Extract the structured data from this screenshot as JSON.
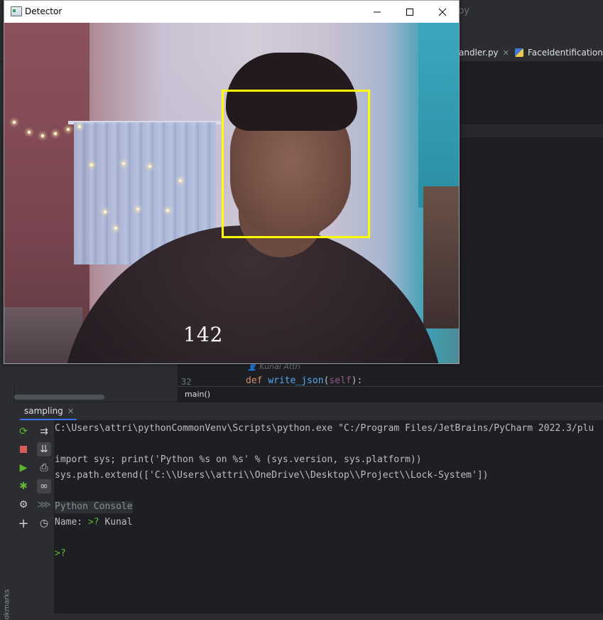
{
  "ide": {
    "title_fragment": "py",
    "tabs": [
      {
        "label": "andler.py"
      },
      {
        "label": "FaceIdentificationM"
      }
    ],
    "editor": {
      "author_hint": "Kunal Attri",
      "line_number": "32",
      "code_keyword": "def ",
      "code_function": "write_json",
      "code_paren_open": "(",
      "code_self": "self",
      "code_tail": "):"
    },
    "breadcrumb": "main()"
  },
  "run_panel": {
    "tab_label": "sampling",
    "console_lines": [
      "C:\\Users\\attri\\pythonCommonVenv\\Scripts\\python.exe \"C:/Program Files/JetBrains/PyCharm 2022.3/plu",
      "",
      "import sys; print('Python %s on %s' % (sys.version, sys.platform))",
      "sys.path.extend(['C:\\\\Users\\\\attri\\\\OneDrive\\\\Desktop\\\\Project\\\\Lock-System'])",
      "",
      "Python Console"
    ],
    "name_prompt_label": "Name: ",
    "name_prompt_marker": ">?",
    "name_value": "Kunal",
    "empty_prompt": ">?",
    "side_label": "okmarks"
  },
  "detector": {
    "title": "Detector",
    "frame_counter": "142"
  },
  "colors": {
    "face_box": "#ffff00",
    "prompt_green": "#5fb832",
    "accent": "#3574f0"
  },
  "icons": {
    "rerun": "rerun-icon",
    "stop": "stop-icon",
    "run": "run-icon",
    "debug": "debug-icon",
    "settings": "settings-icon",
    "add": "add-icon",
    "soft_wrap": "soft-wrap-icon",
    "scroll_end": "scroll-to-end-icon",
    "print": "print-icon",
    "show_vars": "show-variables-icon",
    "history": "history-icon",
    "execute": "execute-icon"
  }
}
